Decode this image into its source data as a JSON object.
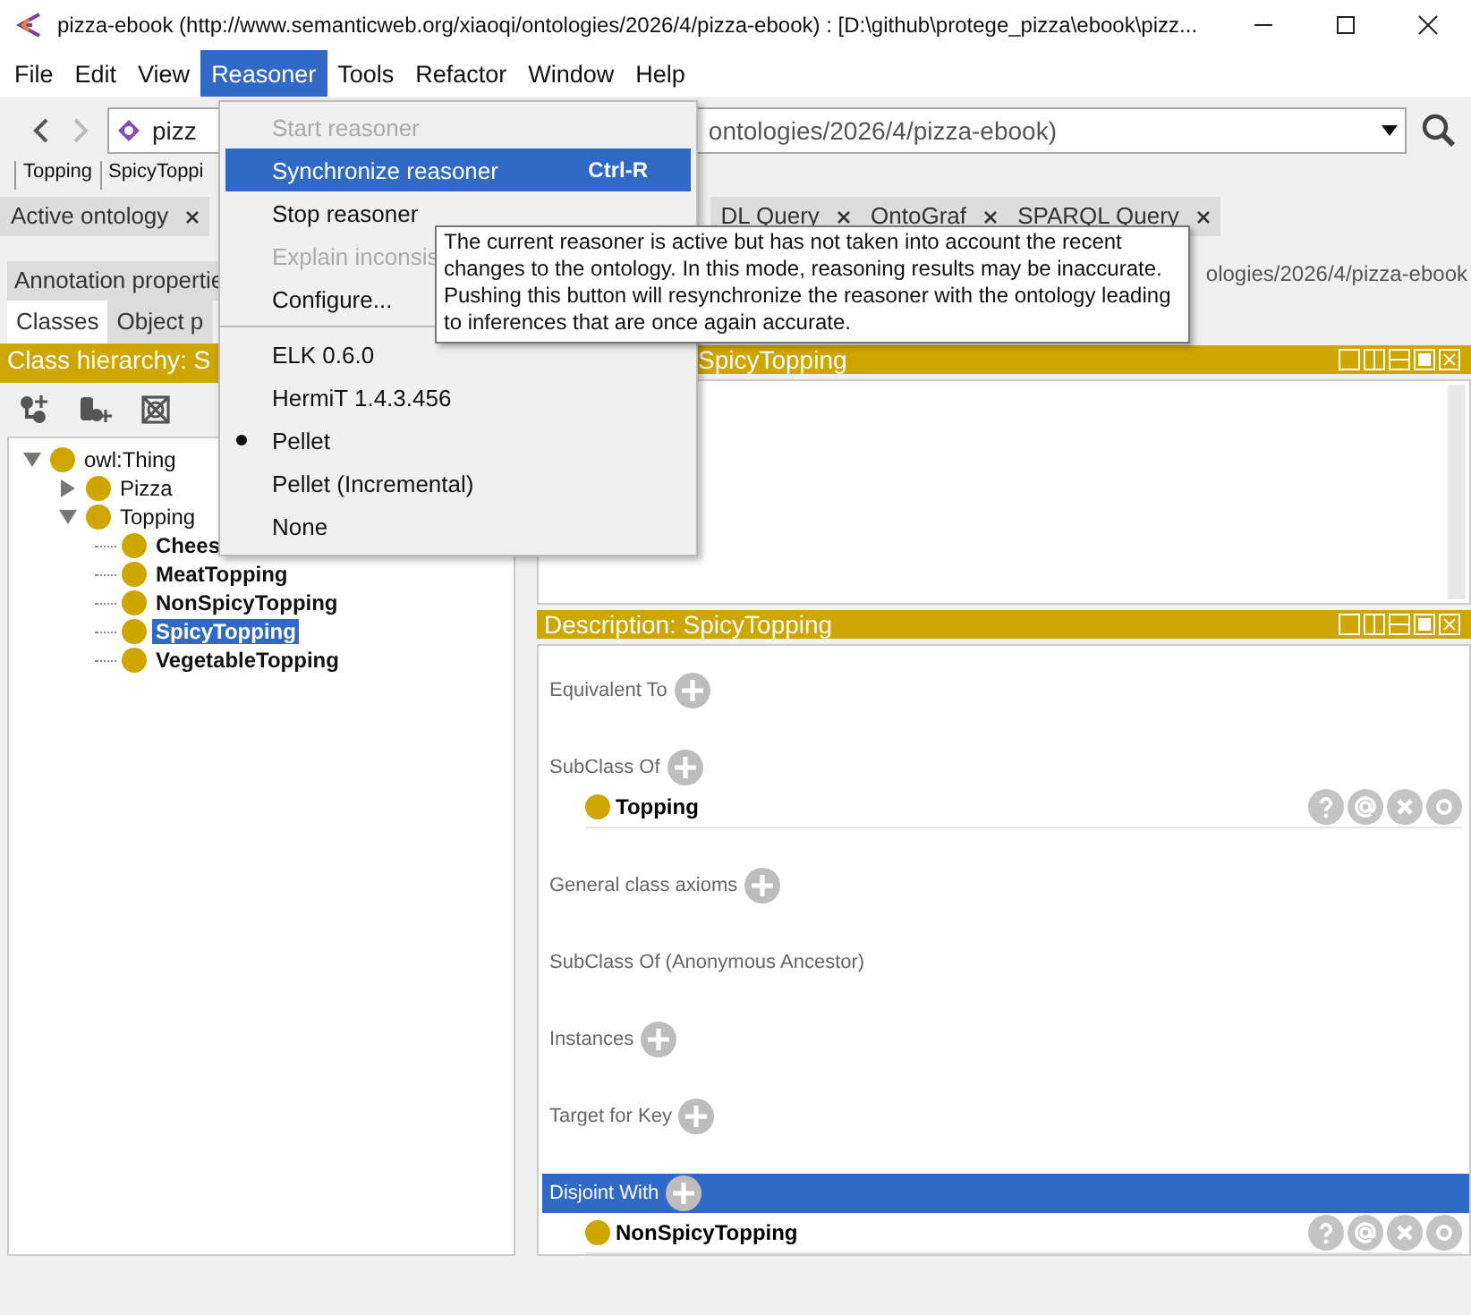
{
  "window": {
    "title": "pizza-ebook (http://www.semanticweb.org/xiaoqi/ontologies/2026/4/pizza-ebook)  : [D:\\github\\protege_pizza\\ebook\\pizz..."
  },
  "menu_bar": [
    {
      "label": "File",
      "selected": false
    },
    {
      "label": "Edit",
      "selected": false
    },
    {
      "label": "View",
      "selected": false
    },
    {
      "label": "Reasoner",
      "selected": true
    },
    {
      "label": "Tools",
      "selected": false
    },
    {
      "label": "Refactor",
      "selected": false
    },
    {
      "label": "Window",
      "selected": false
    },
    {
      "label": "Help",
      "selected": false
    }
  ],
  "open_menu": {
    "items": [
      {
        "kind": "action",
        "label": "Start reasoner",
        "disabled": true,
        "highlighted": false
      },
      {
        "kind": "action",
        "label": "Synchronize reasoner",
        "shortcut": "Ctrl-R",
        "disabled": false,
        "highlighted": true
      },
      {
        "kind": "action",
        "label": "Stop reasoner",
        "disabled": false,
        "highlighted": false
      },
      {
        "kind": "action",
        "label": "Explain inconsis",
        "disabled": true,
        "highlighted": false
      },
      {
        "kind": "action",
        "label": "Configure...",
        "disabled": false,
        "highlighted": false
      },
      {
        "kind": "separator"
      },
      {
        "kind": "radio",
        "label": "ELK 0.6.0",
        "selected": false
      },
      {
        "kind": "radio",
        "label": "HermiT 1.4.3.456",
        "selected": false
      },
      {
        "kind": "radio",
        "label": "Pellet",
        "selected": true
      },
      {
        "kind": "radio",
        "label": "Pellet (Incremental)",
        "selected": false
      },
      {
        "kind": "radio",
        "label": "None",
        "selected": false
      }
    ]
  },
  "tooltip": "The current reasoner is active but has not taken into account the recent changes to the ontology. In this mode, reasoning results may be inaccurate. Pushing this button will resynchronize the reasoner with the ontology leading to inferences that are once again accurate.",
  "address_bar": {
    "value_start": "pizz",
    "value_end": "ontologies/2026/4/pizza-ebook)"
  },
  "breadcrumbs": [
    "Topping",
    "SpicyToppi"
  ],
  "tabs": [
    {
      "label": "Active ontology",
      "selected": false
    },
    {
      "label": "DL Query",
      "selected": false
    },
    {
      "label": "OntoGraf",
      "selected": false
    },
    {
      "label": "SPARQL Query",
      "selected": false
    }
  ],
  "left_panel": {
    "top_tabs": [
      {
        "label": "Annotation propertie",
        "selected": false
      }
    ],
    "sub_tabs": [
      {
        "label": "Classes",
        "selected": true
      },
      {
        "label": "Object p",
        "selected": false
      }
    ],
    "header": "Class hierarchy: S",
    "tree": [
      {
        "label": "owl:Thing",
        "bold": false,
        "selected": false,
        "expanded": true,
        "children": [
          {
            "label": "Pizza",
            "bold": false,
            "selected": false,
            "expanded": false
          },
          {
            "label": "Topping",
            "bold": false,
            "selected": false,
            "expanded": true,
            "children": [
              {
                "label": "Chees",
                "bold": true,
                "selected": false
              },
              {
                "label": "MeatTopping",
                "bold": true,
                "selected": false
              },
              {
                "label": "NonSpicyTopping",
                "bold": true,
                "selected": false
              },
              {
                "label": "SpicyTopping",
                "bold": true,
                "selected": true
              },
              {
                "label": "VegetableTopping",
                "bold": true,
                "selected": false
              }
            ]
          }
        ]
      }
    ]
  },
  "ontology_label": "ologies/2026/4/pizza-ebook",
  "annotations_panel": {
    "header": "SpicyTopping"
  },
  "description_panel": {
    "header": "Description: SpicyTopping",
    "sections": [
      {
        "label": "Equivalent To",
        "addable": true,
        "selected": false
      },
      {
        "label": "SubClass Of",
        "addable": true,
        "selected": false,
        "items": [
          "Topping"
        ]
      },
      {
        "label": "General class axioms",
        "addable": true,
        "selected": false
      },
      {
        "label": "SubClass Of (Anonymous Ancestor)",
        "addable": false,
        "selected": false
      },
      {
        "label": "Instances",
        "addable": true,
        "selected": false
      },
      {
        "label": "Target for Key",
        "addable": true,
        "selected": false
      },
      {
        "label": "Disjoint With",
        "addable": true,
        "selected": true,
        "items": [
          "NonSpicyTopping"
        ]
      }
    ]
  }
}
